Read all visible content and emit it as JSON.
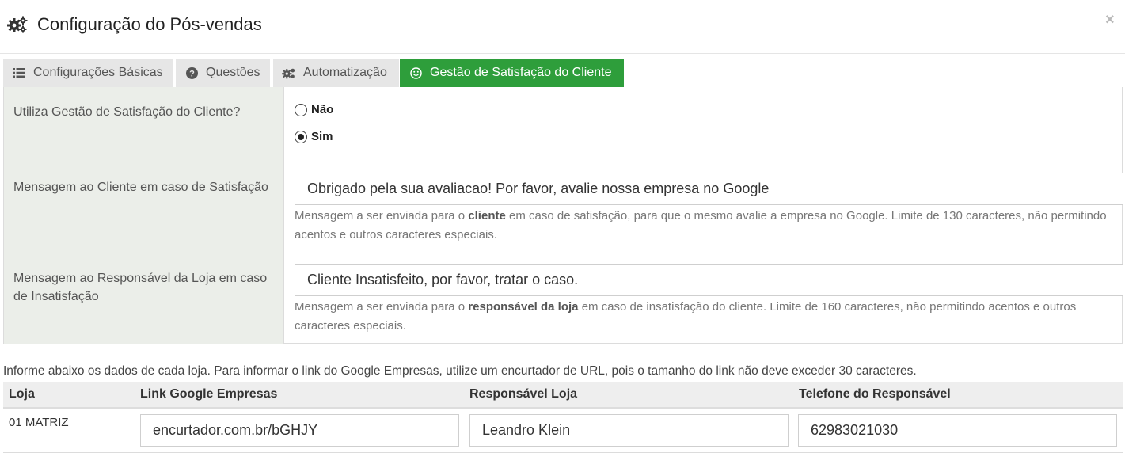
{
  "header": {
    "title": "Configuração do Pós-vendas",
    "close_label": "×",
    "icon": "gears-icon"
  },
  "tabs": [
    {
      "label": "Configurações Básicas",
      "icon": "list-icon",
      "active": false
    },
    {
      "label": "Questões",
      "icon": "question-circle-icon",
      "active": false
    },
    {
      "label": "Automatização",
      "icon": "gears-icon",
      "active": false
    },
    {
      "label": "Gestão de Satisfação do Cliente",
      "icon": "smile-icon",
      "active": true
    }
  ],
  "accent_color": "#2e9e3b",
  "form": {
    "satisfaction": {
      "label": "Utiliza Gestão de Satisfação do Cliente?",
      "options": [
        {
          "label": "Não",
          "checked": false
        },
        {
          "label": "Sim",
          "checked": true
        }
      ]
    },
    "client_message": {
      "label": "Mensagem ao Cliente em caso de Satisfação",
      "value": "Obrigado pela sua avaliacao! Por favor, avalie nossa empresa no Google",
      "help_prefix": "Mensagem a ser enviada para o ",
      "help_bold": "cliente",
      "help_suffix": " em caso de satisfação, para que o mesmo avalie a empresa no Google. Limite de 130 caracteres, não permitindo acentos e outros caracteres especiais."
    },
    "manager_message": {
      "label": "Mensagem ao Responsável da Loja em caso de Insatisfação",
      "value": "Cliente Insatisfeito, por favor, tratar o caso.",
      "help_prefix": "Mensagem a ser enviada para o ",
      "help_bold": "responsável da loja",
      "help_suffix": " em caso de insatisfação do cliente. Limite de 160 caracteres, não permitindo acentos e outros caracteres especiais."
    }
  },
  "stores": {
    "info": "Informe abaixo os dados de cada loja. Para informar o link do Google Empresas, utilize um encurtador de URL, pois o tamanho do link não deve exceder 30 caracteres.",
    "columns": [
      "Loja",
      "Link Google Empresas",
      "Responsável Loja",
      "Telefone do Responsável"
    ],
    "rows": [
      {
        "store": "01 MATRIZ",
        "link": "encurtador.com.br/bGHJY",
        "manager": "Leandro Klein",
        "phone": "62983021030"
      }
    ]
  }
}
